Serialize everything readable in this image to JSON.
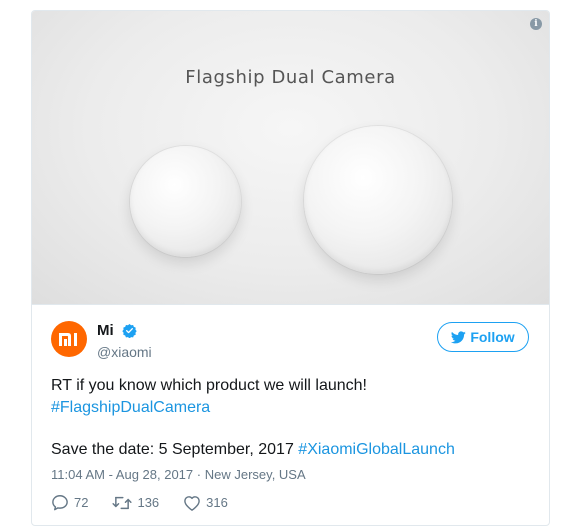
{
  "media": {
    "caption": "Flagship Dual Camera",
    "info_icon": "info-icon"
  },
  "author": {
    "avatar_icon": "mi-logo",
    "name": "Mi",
    "verified_icon": "verified-badge-icon",
    "handle": "@xiaomi"
  },
  "follow": {
    "icon": "twitter-bird-icon",
    "label": "Follow"
  },
  "tweet": {
    "line1": "RT if you know which product we will launch!",
    "hashtag1": "#FlagshipDualCamera",
    "line2": "Save the date: 5 September, 2017",
    "hashtag2": "#XiaomiGlobalLaunch"
  },
  "meta": {
    "time": "11:04 AM - Aug 28, 2017",
    "separator": "·",
    "location": "New Jersey, USA"
  },
  "actions": {
    "replies": "72",
    "retweets": "136",
    "likes": "316"
  },
  "colors": {
    "brand_orange": "#ff6700",
    "twitter_blue": "#1da1f2",
    "link_blue": "#1b95e0"
  }
}
